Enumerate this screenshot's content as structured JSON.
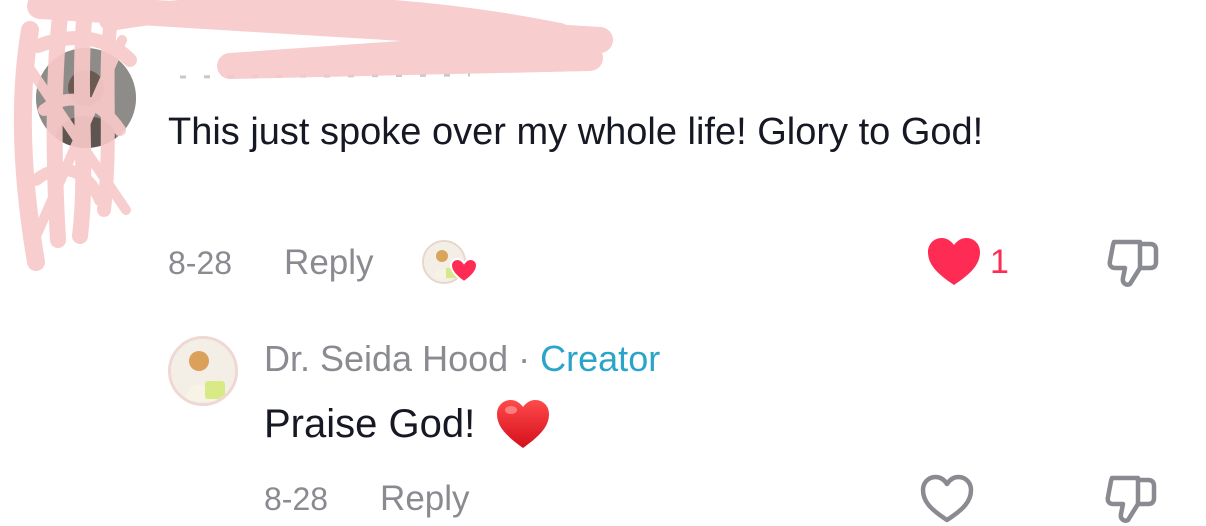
{
  "top_comment": {
    "text": "This just spoke over my whole life! Glory to God!",
    "date": "8-28",
    "reply_label": "Reply",
    "like_count": "1",
    "liked": true
  },
  "reply_comment": {
    "author": "Dr. Seida Hood",
    "separator": "·",
    "badge": "Creator",
    "text": "Praise God!",
    "emoji": "❤️",
    "date": "8-28",
    "reply_label": "Reply",
    "liked": false
  },
  "colors": {
    "like_red": "#fe2c55",
    "creator_blue": "#2aa5c9",
    "meta_gray": "#8a8b91",
    "text_dark": "#161823",
    "redaction_pink": "#f8c9c9"
  },
  "icons": [
    "heart-filled-icon",
    "heart-outline-icon",
    "thumbs-down-icon",
    "creator-liked-heart-icon"
  ]
}
